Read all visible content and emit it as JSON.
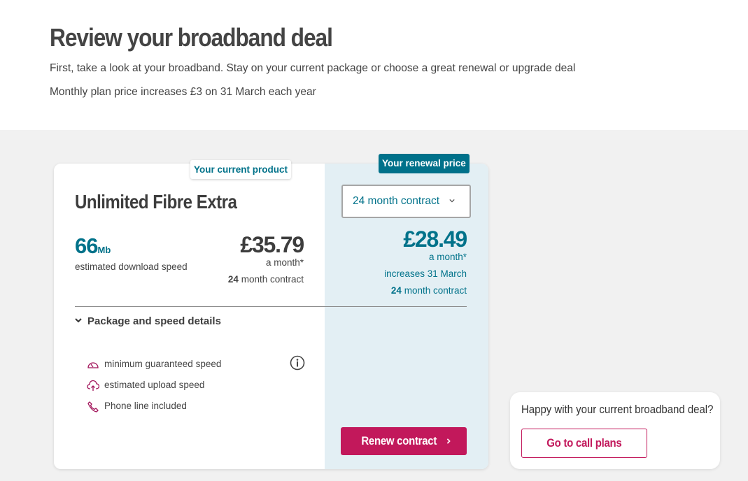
{
  "header": {
    "title": "Review your broadband deal",
    "subtitle": "First, take a look at your broadband. Stay on your current package or choose a great renewal or upgrade deal",
    "price_note": "Monthly plan price increases £3 on 31 March each year"
  },
  "current": {
    "badge": "Your current product",
    "product_name": "Unlimited Fibre Extra",
    "speed_value": "66",
    "speed_unit": "Mb",
    "speed_label": "estimated download speed",
    "price": "£35.79",
    "price_period": "a month*",
    "contract_months": "24",
    "contract_suffix": " month contract"
  },
  "renewal": {
    "badge": "Your renewal price",
    "contract_select": {
      "value": "24 month contract",
      "icon": "chevron-down-icon"
    },
    "price": "£28.49",
    "price_period": "a month*",
    "increase_note": "increases 31 March",
    "contract_months": "24",
    "contract_suffix": " month contract",
    "renew_button": "Renew contract"
  },
  "details": {
    "toggle_label": "Package and speed details",
    "features": [
      {
        "label": "minimum guaranteed speed",
        "icon": "speedometer-icon"
      },
      {
        "label": "estimated upload speed",
        "icon": "cloud-upload-icon"
      },
      {
        "label": "Phone line included",
        "icon": "phone-icon"
      }
    ],
    "info_icon": "info-icon"
  },
  "side": {
    "question": "Happy with your current broadband deal?",
    "call_plans_button": "Go to call plans"
  },
  "colors": {
    "teal": "#00728a",
    "magenta": "#c2185b",
    "renewal_panel": "#e3eff4",
    "band": "#f1f1f1"
  }
}
